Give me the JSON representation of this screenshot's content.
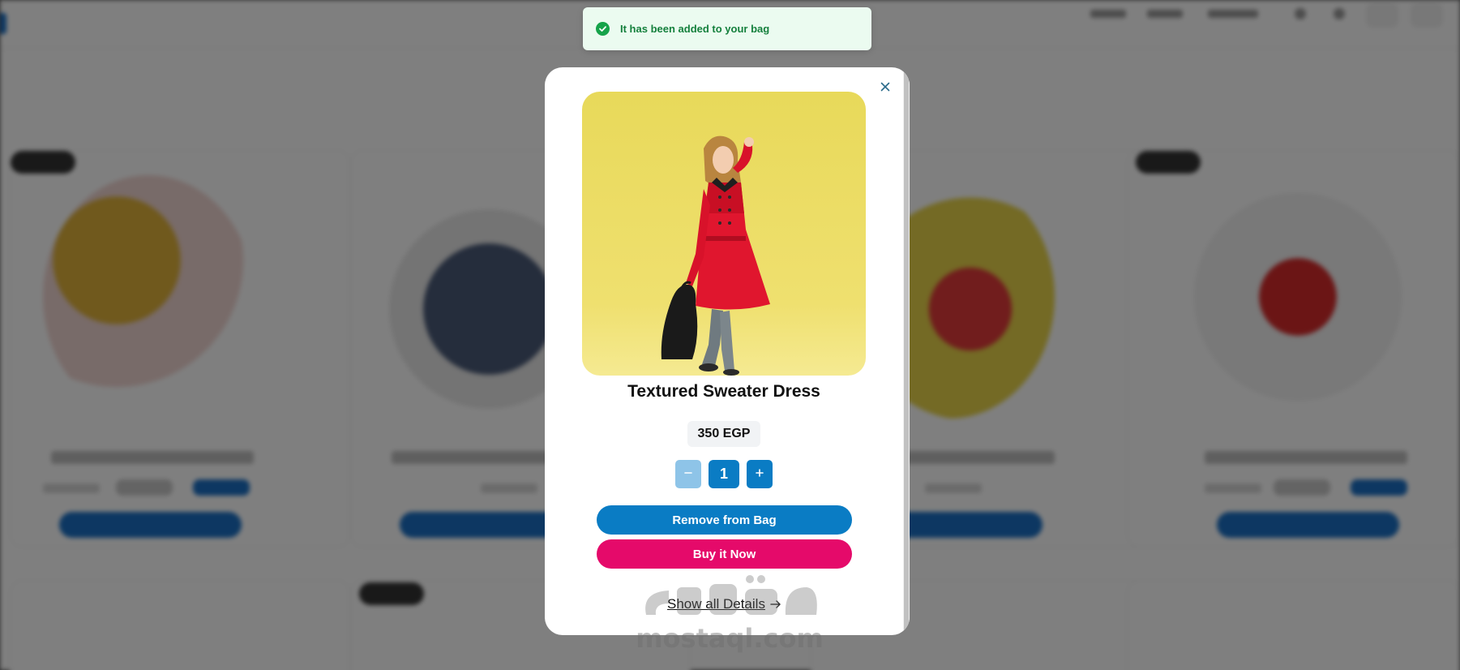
{
  "toast": {
    "message": "It has been added to your bag",
    "icon": "check-circle-icon",
    "color": "#15803d"
  },
  "modal": {
    "close_icon": "close-icon",
    "product": {
      "image_alt": "product-photo",
      "title": "Textured Sweater Dress",
      "price": "350 EGP"
    },
    "quantity": {
      "value": "1",
      "decrement_label": "−",
      "increment_label": "+"
    },
    "actions": {
      "remove_label": "Remove from Bag",
      "buy_label": "Buy it Now",
      "details_label": "Show all Details"
    },
    "colors": {
      "primary": "#0a7cc4",
      "accent": "#e50a6a"
    }
  },
  "watermark": {
    "arabic": "مستقل",
    "latin": "mostaql.com"
  }
}
